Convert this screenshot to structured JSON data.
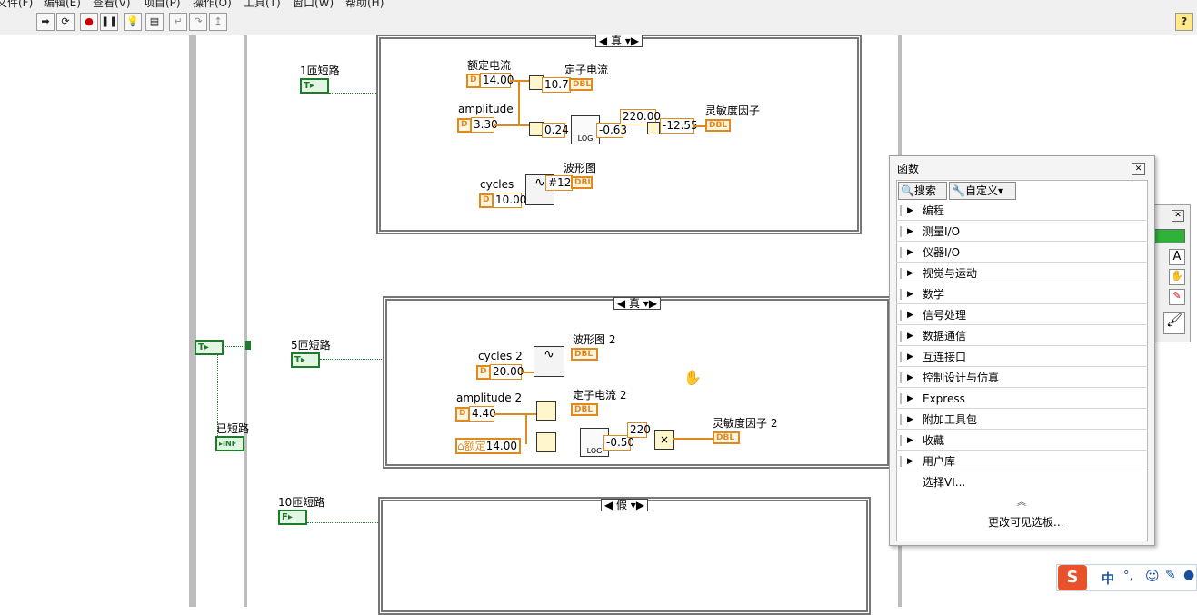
{
  "menu": [
    "文件(F)",
    "编辑(E)",
    "查看(V)",
    "项目(P)",
    "操作(O)",
    "工具(T)",
    "窗口(W)",
    "帮助(H)"
  ],
  "toolbar": {
    "help": "?"
  },
  "diagram": {
    "outer_control": {
      "value": "T"
    },
    "shorted_label": "已短路",
    "shorted_term": "INF",
    "case1": {
      "control_label": "1匝短路",
      "control_value": "T",
      "selector": "真",
      "rated_current_label": "额定电流",
      "rated_current_value": "14.00",
      "stator_current_label": "定子电流",
      "stator_current_value": "10.70",
      "amplitude_label": "amplitude",
      "amplitude_value": "3.30",
      "ratio_value": "0.24",
      "log_value": "-0.63",
      "const_value": "220.00",
      "sensitivity_value": "-12.55",
      "sensitivity_label": "灵敏度因子",
      "waveform_label": "波形图",
      "waveform_value": "#128",
      "cycles_label": "cycles",
      "cycles_value": "10.00"
    },
    "case2": {
      "control_label": "5匝短路",
      "control_value": "T",
      "selector": "真",
      "waveform_label": "波形图 2",
      "cycles_label": "cycles 2",
      "cycles_value": "20.00",
      "amplitude_label": "amplitude 2",
      "amplitude_value": "4.40",
      "stator_current_label": "定子电流 2",
      "rated_local": "额定",
      "rated_value": "14.00",
      "log_value": "-0.50",
      "const_value": "220",
      "sensitivity_label": "灵敏度因子 2"
    },
    "case3": {
      "control_label": "10匝短路",
      "control_value": "F",
      "selector": "假"
    },
    "terms": {
      "dbl": "DBL",
      "dbl_node": "D"
    }
  },
  "palette": {
    "title": "函数",
    "search": "搜索",
    "customize": "自定义",
    "items": [
      "编程",
      "测量I/O",
      "仪器I/O",
      "视觉与运动",
      "数学",
      "信号处理",
      "数据通信",
      "互连接口",
      "控制设计与仿真",
      "Express",
      "附加工具包",
      "收藏",
      "用户库",
      "选择VI..."
    ],
    "change_visible": "更改可见选板..."
  },
  "ime": {
    "mode": "中",
    "punct": "°,"
  }
}
